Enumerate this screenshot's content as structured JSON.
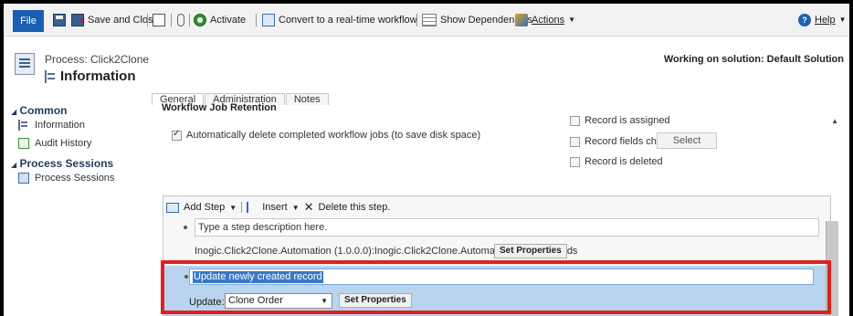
{
  "ribbon": {
    "file": "File",
    "save_close": "Save and Close",
    "activate": "Activate",
    "convert": "Convert to a real-time workflow",
    "show_dependencies": "Show Dependencies",
    "actions": "Actions",
    "help": "Help"
  },
  "header": {
    "process": "Process: Click2Clone",
    "title": "Information",
    "solution": "Working on solution: Default Solution"
  },
  "nav": {
    "common": "Common",
    "information": "Information",
    "audit_history": "Audit History",
    "process_sessions_group": "Process Sessions",
    "process_sessions_item": "Process Sessions"
  },
  "tabs": [
    "General",
    "Administration",
    "Notes"
  ],
  "retention": {
    "heading": "Workflow Job Retention",
    "auto_delete": "Automatically delete completed workflow jobs (to save disk space)"
  },
  "triggers": {
    "assigned": "Record is assigned",
    "fields_change": "Record fields change",
    "select": "Select",
    "deleted": "Record is deleted"
  },
  "designer": {
    "add_step": "Add Step",
    "insert": "Insert",
    "delete": "Delete this step.",
    "step1": {
      "desc_placeholder": "Type a step description here.",
      "name": "Inogic.Click2Clone.Automation (1.0.0.0):Inogic.Click2Clone.Automation.CloneRecords",
      "set_properties": "Set Properties"
    },
    "step2": {
      "desc": "Update newly created record",
      "update_label": "Update:",
      "entity": "Clone Order",
      "set_properties": "Set Properties"
    }
  },
  "colors": {
    "highlight_border": "#e02020",
    "selected_step_bg": "#b8d4ee",
    "file_button": "#1a5fb4"
  }
}
